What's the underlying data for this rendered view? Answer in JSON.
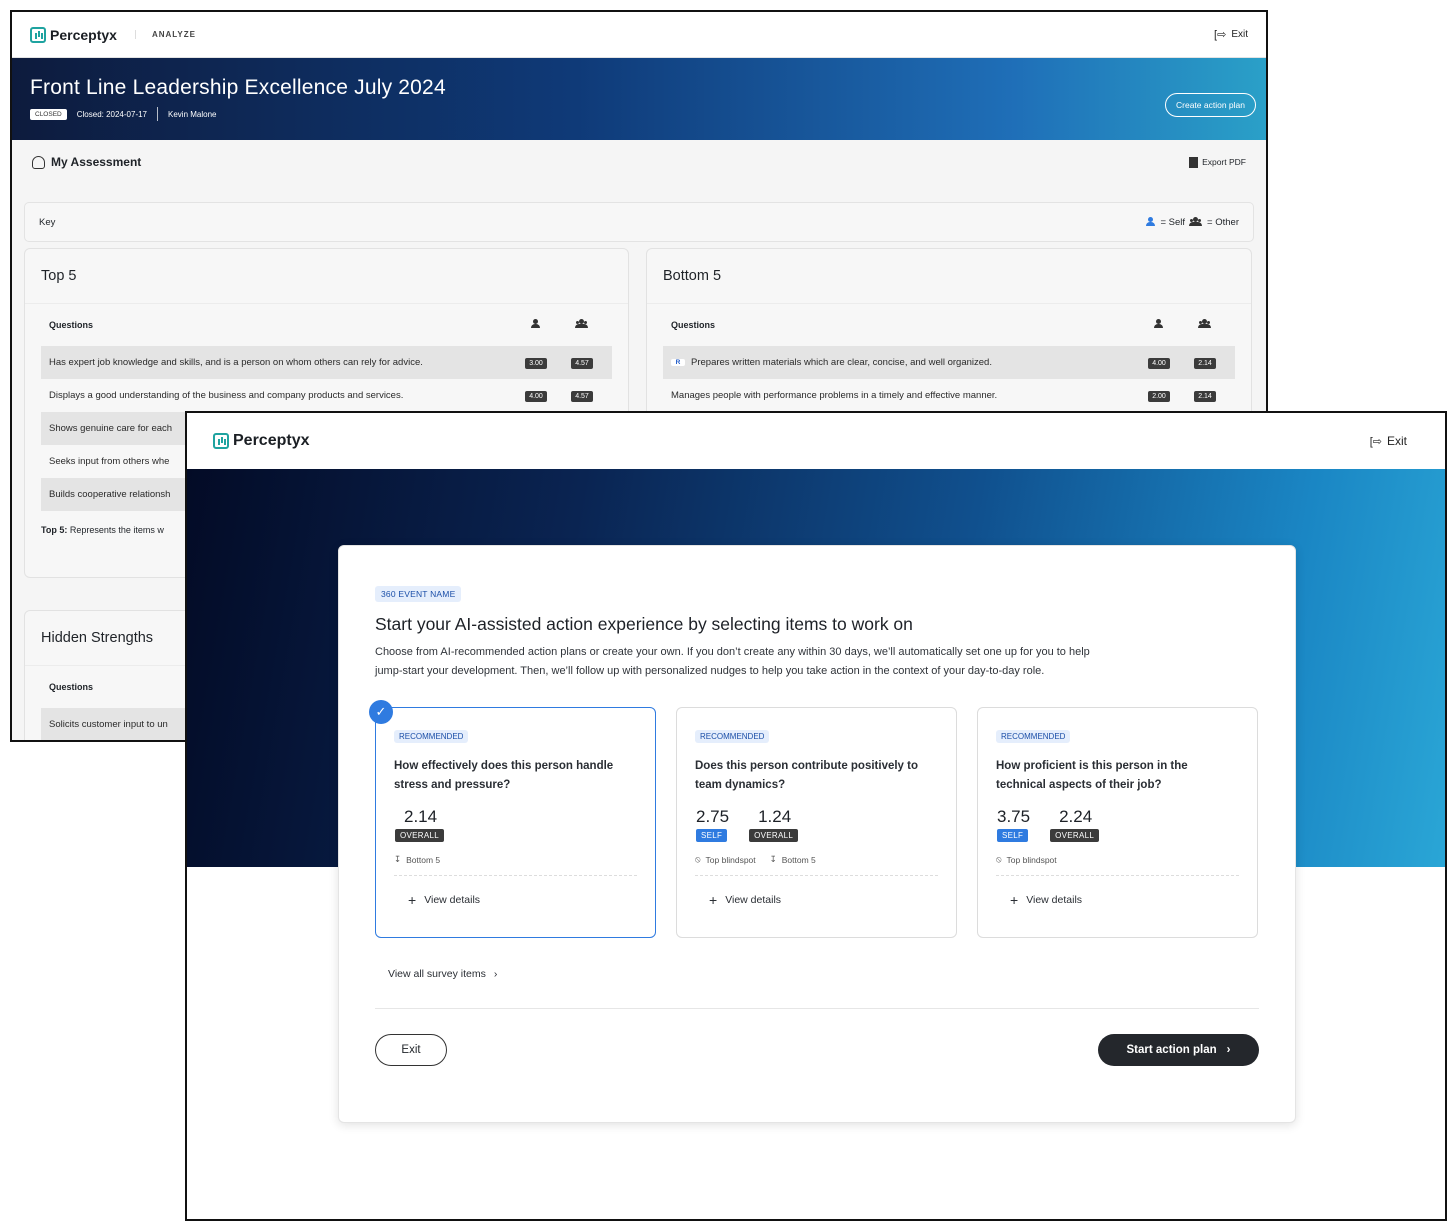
{
  "back": {
    "brand": "Perceptyx",
    "section": "ANALYZE",
    "exit_label": "Exit",
    "title": "Front Line Leadership Excellence July 2024",
    "status": "CLOSED",
    "closed": "Closed: 2024-07-17",
    "owner": "Kevin Malone",
    "create_action_plan": "Create action plan",
    "assessment_title": "My Assessment",
    "export_pdf": "Export PDF",
    "key_label": "Key",
    "key_self": "= Self",
    "key_other": "= Other",
    "top5": {
      "title": "Top 5",
      "col_questions": "Questions",
      "rows": [
        {
          "text": "Has expert job knowledge and skills, and is a person on whom others can rely for advice.",
          "self": "3.00",
          "other": "4.57"
        },
        {
          "text": "Displays a good understanding of the business and company products and services.",
          "self": "4.00",
          "other": "4.57"
        },
        {
          "text": "Shows genuine care for each"
        },
        {
          "text": "Seeks input from others whe"
        },
        {
          "text": "Builds cooperative relationsh"
        }
      ],
      "footnote_bold": "Top 5:",
      "footnote": "Represents the items w"
    },
    "bottom5": {
      "title": "Bottom 5",
      "col_questions": "Questions",
      "rows": [
        {
          "tag": "R",
          "text": "Prepares written materials which are clear, concise, and well organized.",
          "self": "4.00",
          "other": "2.14"
        },
        {
          "text": "Manages people with performance problems in a timely and effective manner.",
          "self": "2.00",
          "other": "2.14"
        }
      ]
    },
    "hidden": {
      "title": "Hidden Strengths",
      "col_questions": "Questions",
      "rows": [
        {
          "text": "Solicits customer input to un"
        }
      ]
    }
  },
  "front": {
    "brand": "Perceptyx",
    "exit_label": "Exit",
    "event_name": "360 EVENT NAME",
    "heading": "Start your AI-assisted action experience by selecting items to work on",
    "description": "Choose from AI-recommended action plans or create your own. If you don’t create any within 30 days, we’ll automatically set one up for you to help jump-start your development. Then, we’ll follow up with personalized nudges to help you take action in the context of your day-to-day role.",
    "cards": [
      {
        "tag": "RECOMMENDED",
        "question": "How effectively does this person handle stress and pressure?",
        "overall": "2.14",
        "overall_label": "OVERALL",
        "flags": [
          "Bottom 5"
        ],
        "view": "View details",
        "selected": true
      },
      {
        "tag": "RECOMMENDED",
        "question": "Does this person contribute positively to team dynamics?",
        "self": "2.75",
        "self_label": "SELF",
        "overall": "1.24",
        "overall_label": "OVERALL",
        "flags": [
          "Top blindspot",
          "Bottom 5"
        ],
        "view": "View details"
      },
      {
        "tag": "RECOMMENDED",
        "question": "How proficient is this person in the technical aspects of their job?",
        "self": "3.75",
        "self_label": "SELF",
        "overall": "2.24",
        "overall_label": "OVERALL",
        "flags": [
          "Top blindspot"
        ],
        "view": "View details"
      }
    ],
    "view_all": "View all survey items",
    "exit_button": "Exit",
    "start_button": "Start action plan"
  },
  "colors": {
    "accent": "#2f7be0",
    "teal": "#1fa3a0",
    "dark_button": "#24272c"
  }
}
